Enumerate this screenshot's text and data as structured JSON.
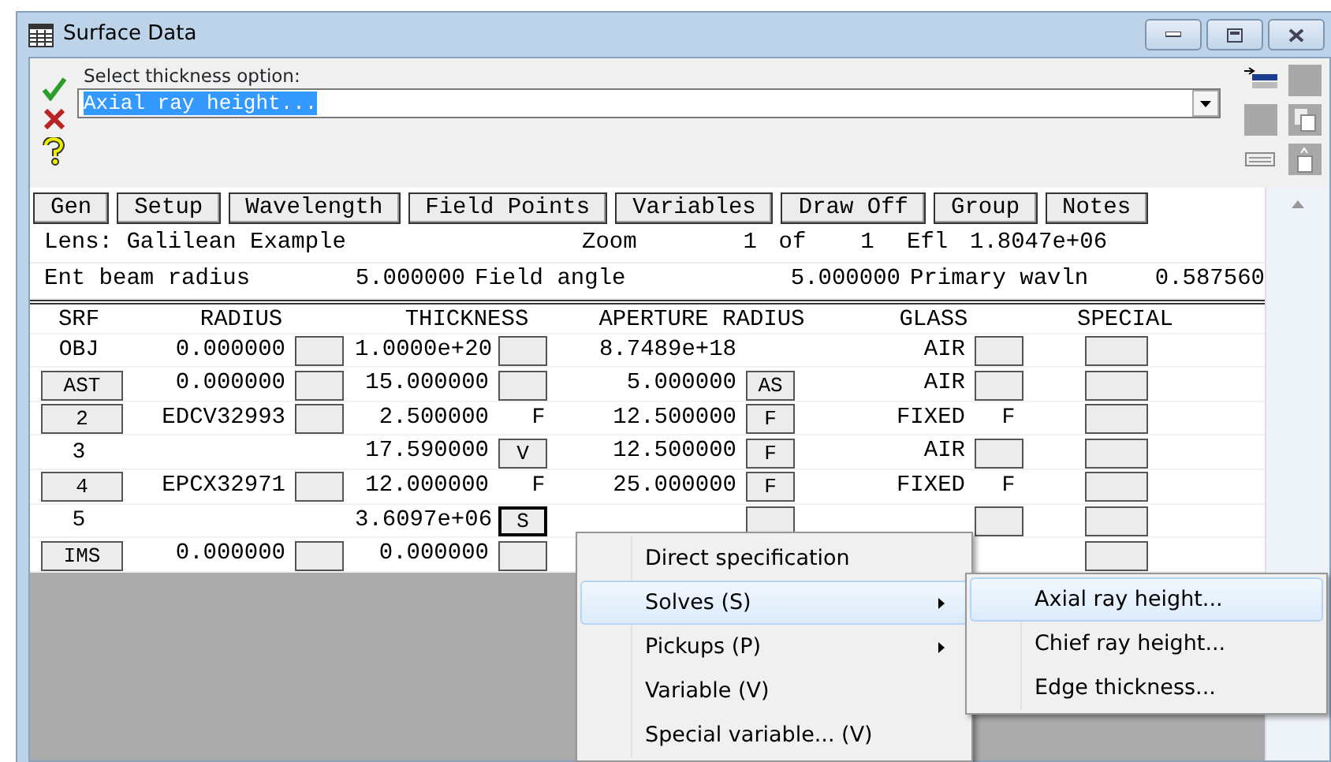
{
  "window": {
    "title": "Surface Data"
  },
  "prompt": {
    "label": "Select thickness option:",
    "value": "Axial ray height...",
    "highlighted": true
  },
  "buttons": [
    {
      "label": "Gen"
    },
    {
      "label": "Setup"
    },
    {
      "label": "Wavelength"
    },
    {
      "label": "Field Points"
    },
    {
      "label": "Variables"
    },
    {
      "label": "Draw Off"
    },
    {
      "label": "Group"
    },
    {
      "label": "Notes"
    }
  ],
  "lens_line": [
    "Lens: Galilean Example",
    "Zoom",
    "1",
    "of",
    "1",
    "Efl",
    "1.8047e+06"
  ],
  "beam_line": [
    "Ent beam radius",
    "5.000000",
    "Field angle",
    "5.000000",
    "Primary wavln",
    "0.587560"
  ],
  "columns": [
    "SRF",
    "RADIUS",
    "THICKNESS",
    "APERTURE RADIUS",
    "GLASS",
    "SPECIAL"
  ],
  "rows": [
    {
      "surface": "OBJ",
      "surface_button": false,
      "radius": "0.000000",
      "radius_solve": {
        "kind": "box"
      },
      "thickness": "1.0000e+20",
      "thickness_solve": {
        "kind": "box"
      },
      "aperture": "8.7489e+18",
      "glass": "AIR",
      "glass_solve": {
        "kind": "box"
      },
      "special": {
        "kind": "box"
      }
    },
    {
      "surface": "AST",
      "surface_button": true,
      "radius": "0.000000",
      "radius_solve": {
        "kind": "box"
      },
      "thickness": "15.000000",
      "thickness_solve": {
        "kind": "box"
      },
      "aperture": "5.000000",
      "aperture_solve": {
        "kind": "box",
        "text": "AS"
      },
      "glass": "AIR",
      "glass_solve": {
        "kind": "box"
      },
      "special": {
        "kind": "box"
      }
    },
    {
      "surface": "2",
      "surface_button": true,
      "radius": "EDCV32993",
      "radius_solve": {
        "kind": "box"
      },
      "thickness": "2.500000",
      "thickness_solve": {
        "kind": "plain",
        "text": "F"
      },
      "aperture": "12.500000",
      "aperture_solve": {
        "kind": "box",
        "text": "F"
      },
      "glass": "FIXED",
      "glass_solve": {
        "kind": "plain",
        "text": "F"
      },
      "special": {
        "kind": "box"
      }
    },
    {
      "surface": "3",
      "surface_button": false,
      "thickness": "17.590000",
      "thickness_solve": {
        "kind": "box",
        "text": "V"
      },
      "aperture": "12.500000",
      "aperture_solve": {
        "kind": "box",
        "text": "F"
      },
      "glass": "AIR",
      "glass_solve": {
        "kind": "box"
      },
      "special": {
        "kind": "box"
      }
    },
    {
      "surface": "4",
      "surface_button": true,
      "radius": "EPCX32971",
      "radius_solve": {
        "kind": "box"
      },
      "thickness": "12.000000",
      "thickness_solve": {
        "kind": "plain",
        "text": "F"
      },
      "aperture": "25.000000",
      "aperture_solve": {
        "kind": "box",
        "text": "F"
      },
      "glass": "FIXED",
      "glass_solve": {
        "kind": "plain",
        "text": "F"
      },
      "special": {
        "kind": "box"
      }
    },
    {
      "surface": "5",
      "surface_button": false,
      "thickness": "3.6097e+06",
      "thickness_solve": {
        "kind": "box",
        "text": "S",
        "focused": true
      },
      "aperture_solve": {
        "kind": "box"
      },
      "glass_solve": {
        "kind": "box"
      },
      "special": {
        "kind": "box"
      }
    },
    {
      "surface": "IMS",
      "surface_button": true,
      "radius": "0.000000",
      "radius_solve": {
        "kind": "box"
      },
      "thickness": "0.000000",
      "thickness_solve": {
        "kind": "box"
      },
      "special": {
        "kind": "box"
      }
    }
  ],
  "context_menu": [
    {
      "label": "Direct specification",
      "selected": false,
      "submenu": false
    },
    {
      "label": "Solves (S)",
      "selected": true,
      "submenu": true
    },
    {
      "label": "Pickups (P)",
      "selected": false,
      "submenu": true
    },
    {
      "label": "Variable (V)",
      "selected": false,
      "submenu": false
    },
    {
      "label": "Special variable... (V)",
      "selected": false,
      "submenu": false
    }
  ],
  "submenu": [
    {
      "label": "Axial ray height...",
      "selected": true
    },
    {
      "label": "Chief ray height...",
      "selected": false
    },
    {
      "label": "Edge thickness...",
      "selected": false
    }
  ]
}
